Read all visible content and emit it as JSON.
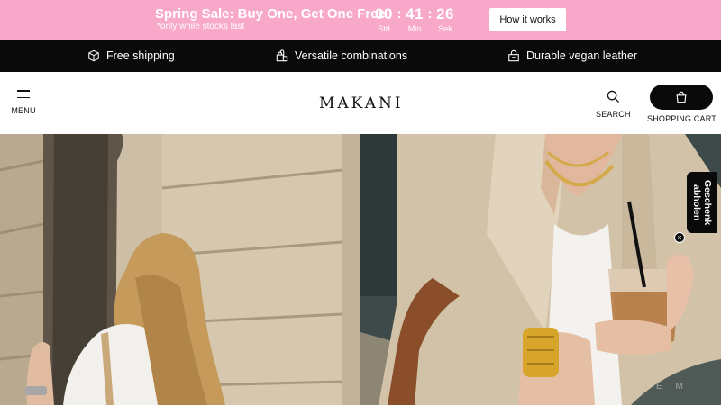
{
  "promo": {
    "title": "Spring Sale: Buy One, Get One Free",
    "subtitle": "*only while stocks last",
    "timer": {
      "hours": "00",
      "hours_label": "Std",
      "minutes": "41",
      "minutes_label": "Min",
      "seconds": "26",
      "seconds_label": "Sek",
      "separator": ":"
    },
    "cta": "How it works",
    "background_color": "#f8a8c8"
  },
  "features": [
    {
      "label": "Free shipping",
      "icon": "box-icon"
    },
    {
      "label": "Versatile combinations",
      "icon": "bags-icon"
    },
    {
      "label": "Durable vegan leather",
      "icon": "handbag-icon"
    }
  ],
  "header": {
    "menu_label": "MENU",
    "logo": "MAKANI",
    "search_label": "SEARCH",
    "cart_label": "SHOPPING CART"
  },
  "gift_tab": {
    "label": "Geschenk\nabholen",
    "close": "×"
  },
  "hero": {
    "watermark": "E M"
  }
}
